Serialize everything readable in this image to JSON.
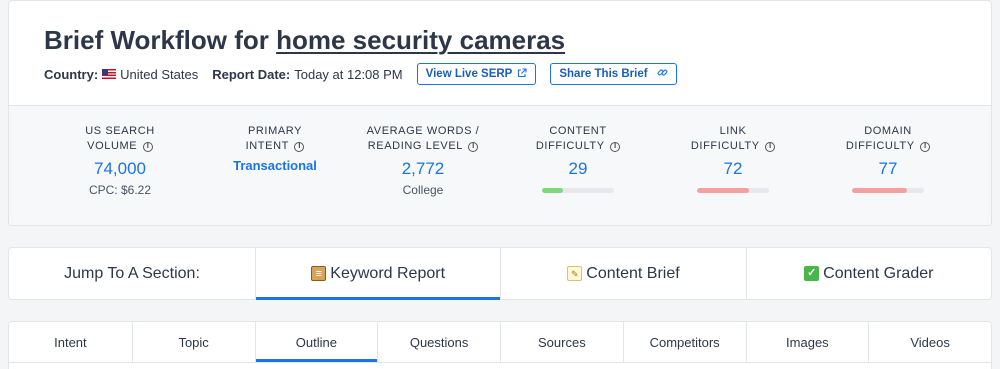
{
  "header": {
    "title_prefix": "Brief Workflow for",
    "keyword": "home security cameras",
    "country_label": "Country:",
    "country_value": "United States",
    "report_date_label": "Report Date:",
    "report_date_value": "Today at 12:08 PM",
    "view_live_serp_label": "View Live SERP",
    "share_brief_label": "Share This Brief"
  },
  "metrics": {
    "search_volume": {
      "label_line1": "US SEARCH",
      "label_line2": "VOLUME",
      "value": "74,000",
      "sub": "CPC: $6.22"
    },
    "primary_intent": {
      "label_line1": "PRIMARY",
      "label_line2": "INTENT",
      "value": "Transactional"
    },
    "avg_words": {
      "label_line1": "AVERAGE WORDS /",
      "label_line2": "READING LEVEL",
      "value": "2,772",
      "sub": "College"
    },
    "content_difficulty": {
      "label_line1": "CONTENT",
      "label_line2": "DIFFICULTY",
      "value": "29",
      "level": 0.29,
      "color": "#7ed67e"
    },
    "link_difficulty": {
      "label_line1": "LINK",
      "label_line2": "DIFFICULTY",
      "value": "72",
      "level": 0.72,
      "color": "#f2a0a0"
    },
    "domain_difficulty": {
      "label_line1": "DOMAIN",
      "label_line2": "DIFFICULTY",
      "value": "77",
      "level": 0.77,
      "color": "#f2a0a0"
    }
  },
  "jump": {
    "label": "Jump To A Section:",
    "tabs": [
      {
        "label": "Keyword Report",
        "icon": "clipboard-icon"
      },
      {
        "label": "Content Brief",
        "icon": "memo-icon"
      },
      {
        "label": "Content Grader",
        "icon": "check-mark-icon"
      }
    ],
    "active_index": 0
  },
  "subtabs": {
    "items": [
      "Intent",
      "Topic",
      "Outline",
      "Questions",
      "Sources",
      "Competitors",
      "Images",
      "Videos"
    ],
    "active_index": 2
  },
  "colors": {
    "accent": "#1a73e8",
    "text": "#2d3748"
  }
}
